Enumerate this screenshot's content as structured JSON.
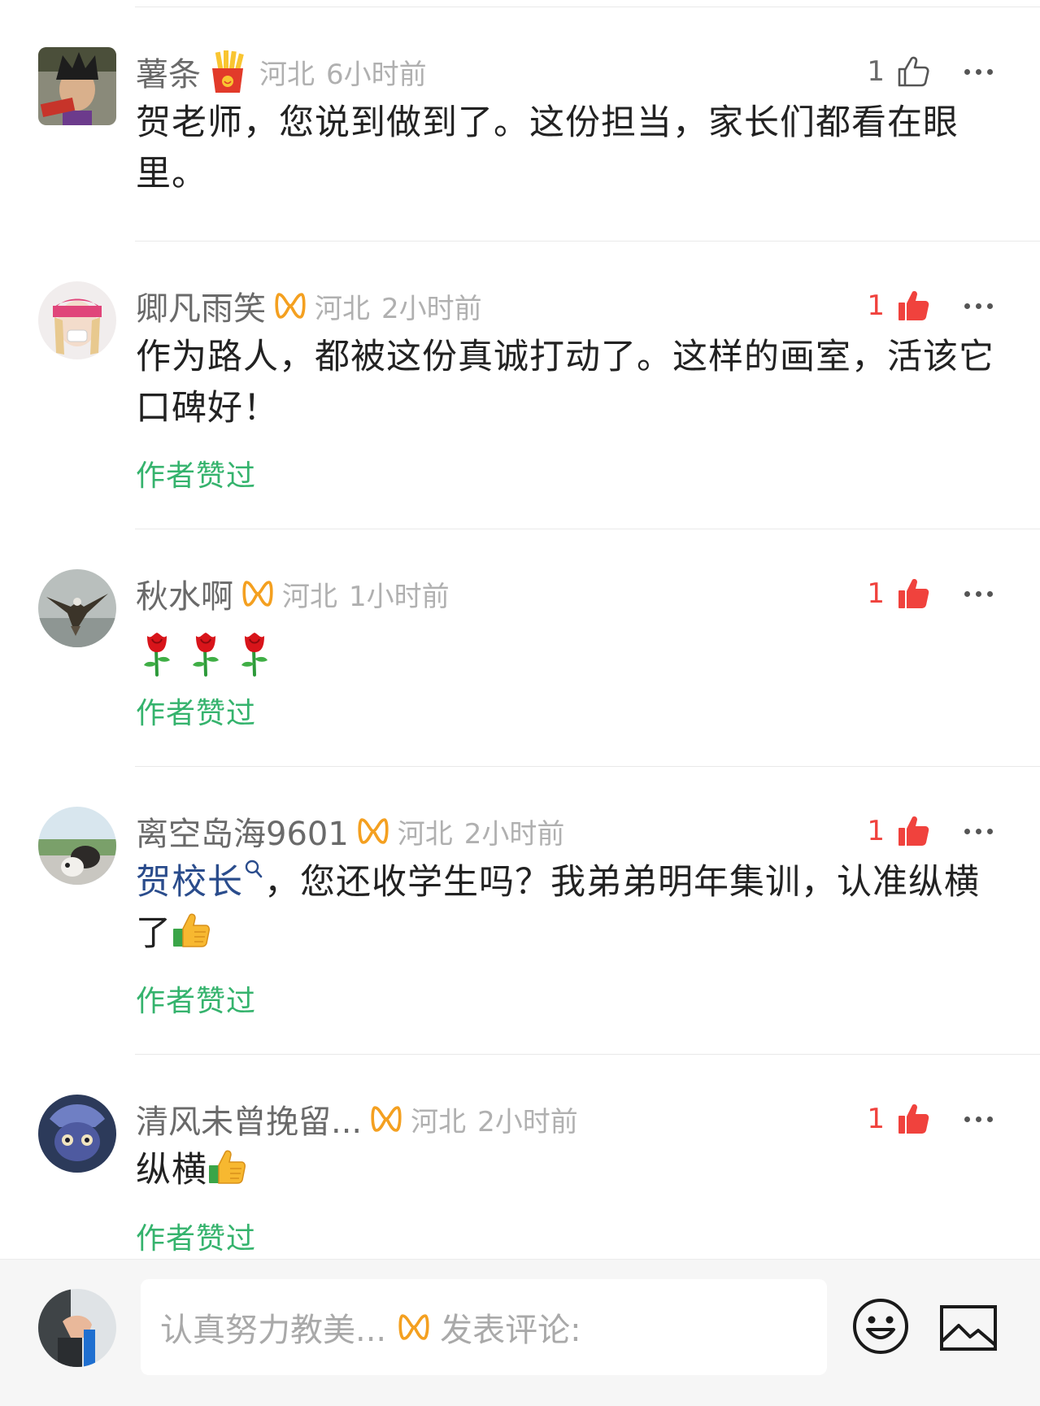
{
  "colors": {
    "like_active": "#f0423d",
    "author_liked": "#35b36d",
    "mention": "#2a4c8c",
    "badge": "#f4a020",
    "meta": "#b0b0b0"
  },
  "comments": [
    {
      "name": "薯条",
      "badge": "fries-icon",
      "region": "河北",
      "time": "6小时前",
      "likes": "1",
      "liked": false,
      "text": "贺老师，您说到做到了。这份担当，家长们都看在眼里。"
    },
    {
      "name": "卿凡雨笑",
      "badge": "infinity-badge-icon",
      "region": "河北",
      "time": "2小时前",
      "likes": "1",
      "liked": true,
      "text": "作为路人，都被这份真诚打动了。这样的画室，活该它口碑好！",
      "author_liked": "作者赞过"
    },
    {
      "name": "秋水啊",
      "badge": "infinity-badge-icon",
      "region": "河北",
      "time": "1小时前",
      "likes": "1",
      "liked": true,
      "text_emoji": [
        "rose-icon",
        "rose-icon",
        "rose-icon"
      ],
      "author_liked": "作者赞过"
    },
    {
      "name": "离空岛海9601",
      "badge": "infinity-badge-icon",
      "region": "河北",
      "time": "2小时前",
      "likes": "1",
      "liked": true,
      "mention": "贺校长",
      "text": "，您还收学生吗？我弟弟明年集训，认准纵横了",
      "author_liked": "作者赞过"
    },
    {
      "name": "清风未曾挽留...",
      "badge": "infinity-badge-icon",
      "region": "河北",
      "time": "2小时前",
      "likes": "1",
      "liked": true,
      "text": "纵横",
      "author_liked": "作者赞过"
    }
  ],
  "composer": {
    "user": "认真努力教美...",
    "placeholder": "发表评论:",
    "emoji_button": "smiley-icon",
    "image_button": "image-icon"
  }
}
